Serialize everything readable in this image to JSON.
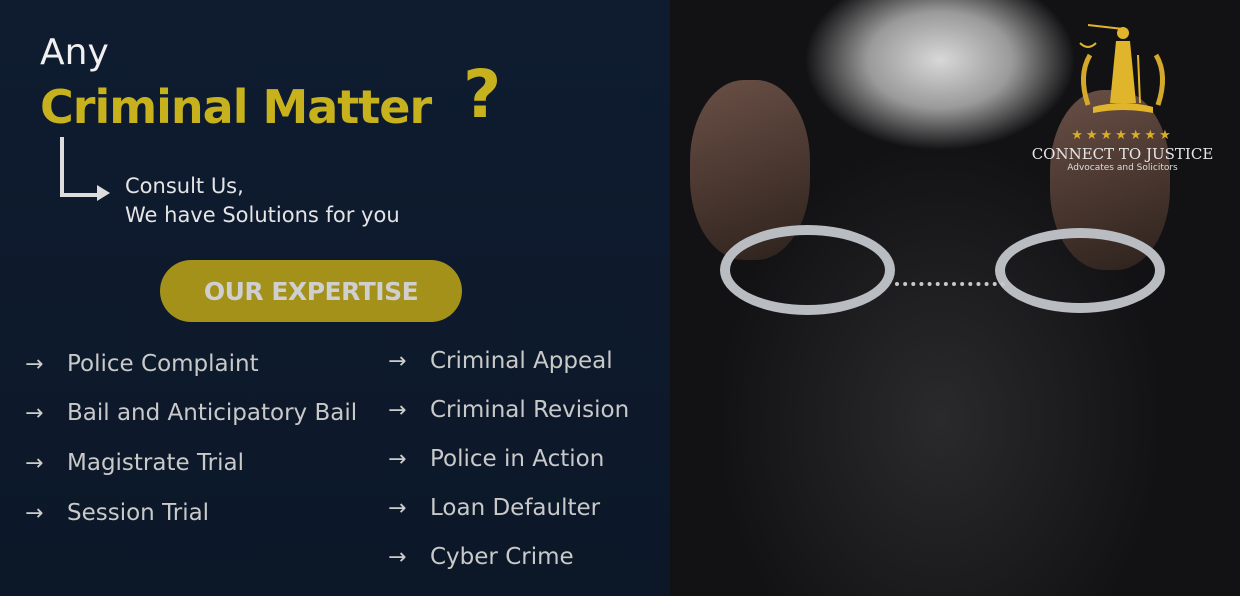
{
  "headline": {
    "line1": "Any",
    "line2": "Criminal Matter",
    "mark": "?"
  },
  "consult": {
    "line1": "Consult Us,",
    "line2": "We have Solutions for you"
  },
  "cta": {
    "label": "OUR EXPERTISE"
  },
  "expertise_left": [
    "Police Complaint",
    "Bail and Anticipatory Bail",
    "Magistrate Trial",
    "Session Trial"
  ],
  "expertise_right": [
    "Criminal Appeal",
    "Criminal Revision",
    "Police in Action",
    "Loan Defaulter",
    "Cyber Crime"
  ],
  "logo": {
    "stars": "★★★★★★★",
    "title": "CONNECT TO JUSTICE",
    "subtitle": "Advocates and Solicitors"
  },
  "colors": {
    "accent": "#c7b21e",
    "panel": "#0f1c30",
    "button": "#a3911a"
  }
}
